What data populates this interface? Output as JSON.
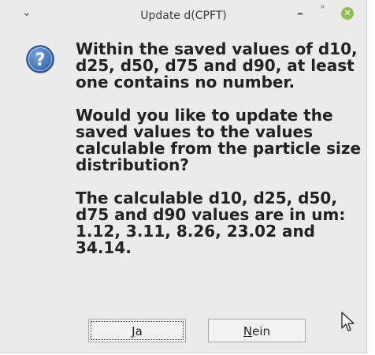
{
  "window": {
    "title": "Update d(CPFT)",
    "menu_icon": "chevron-down-icon",
    "min_glyph": "–",
    "max_glyph": "˚",
    "close_glyph": "✕"
  },
  "message": {
    "para1": "Within the saved values of d10, d25, d50, d75 and d90, at least one contains no number.",
    "para2": "Would you like to update the saved values to the values calculable from the particle size distribution?",
    "para3": "The calculable d10, d25, d50, d75 and d90 values are in um: 1.12, 3.11, 8.26, 23.02 and 34.14."
  },
  "buttons": {
    "yes_mnemonic": "J",
    "yes_rest": "a",
    "no_mnemonic": "N",
    "no_rest": "ein"
  },
  "colors": {
    "close_button": "#8cc152",
    "question_icon": "#3a6fb5"
  }
}
